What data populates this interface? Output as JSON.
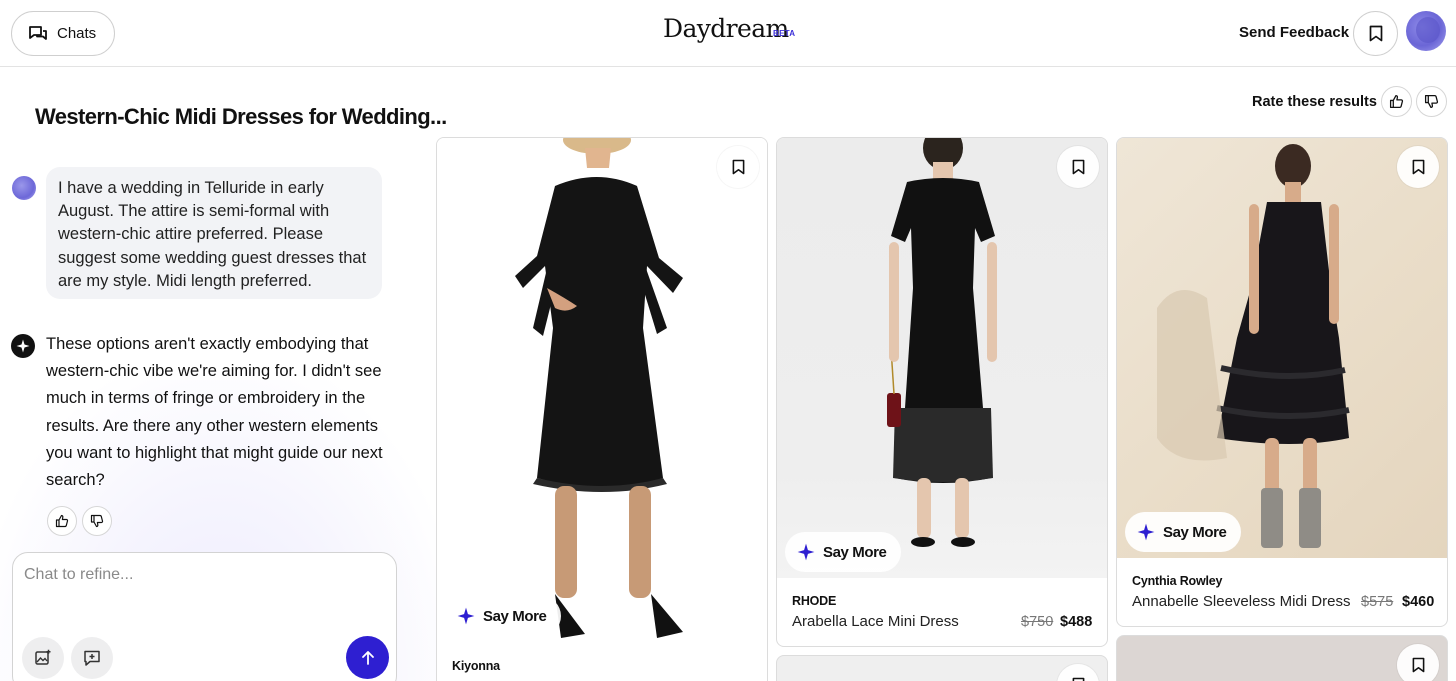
{
  "header": {
    "chats_label": "Chats",
    "logo": "Daydream",
    "beta": "BETA",
    "feedback_label": "Send Feedback",
    "icons": {
      "chats": "chat-bubbles-icon",
      "bookmark": "bookmark-icon",
      "avatar": "user-avatar"
    }
  },
  "conversation": {
    "title": "Western-Chic Midi Dresses for Wedding...",
    "user_message": "I have a wedding in Telluride in early August. The attire is semi-formal with western-chic attire preferred. Please suggest some wedding guest dresses that are my style. Midi length preferred.",
    "assistant_message": "These options aren't exactly embodying that western-chic vibe we're aiming for. I didn't see much in terms of fringe or embroidery in the results. Are there any other western elements you want to highlight that might guide our next search?",
    "chat_placeholder": "Chat to refine..."
  },
  "rating": {
    "label": "Rate these results"
  },
  "colors": {
    "accent": "#2e1fd1",
    "bubble": "#f2f3f6",
    "border": "#dcdcdc"
  },
  "products": [
    {
      "brand": "Kiyonna",
      "name": "",
      "price_old": "",
      "price_new": "",
      "say_more": "Say More"
    },
    {
      "brand": "RHODE",
      "name": "Arabella Lace Mini Dress",
      "price_old": "$750",
      "price_new": "$488",
      "say_more": "Say More"
    },
    {
      "brand": "Cynthia Rowley",
      "name": "Annabelle Sleeveless Midi Dress",
      "price_old": "$575",
      "price_new": "$460",
      "say_more": "Say More"
    }
  ]
}
